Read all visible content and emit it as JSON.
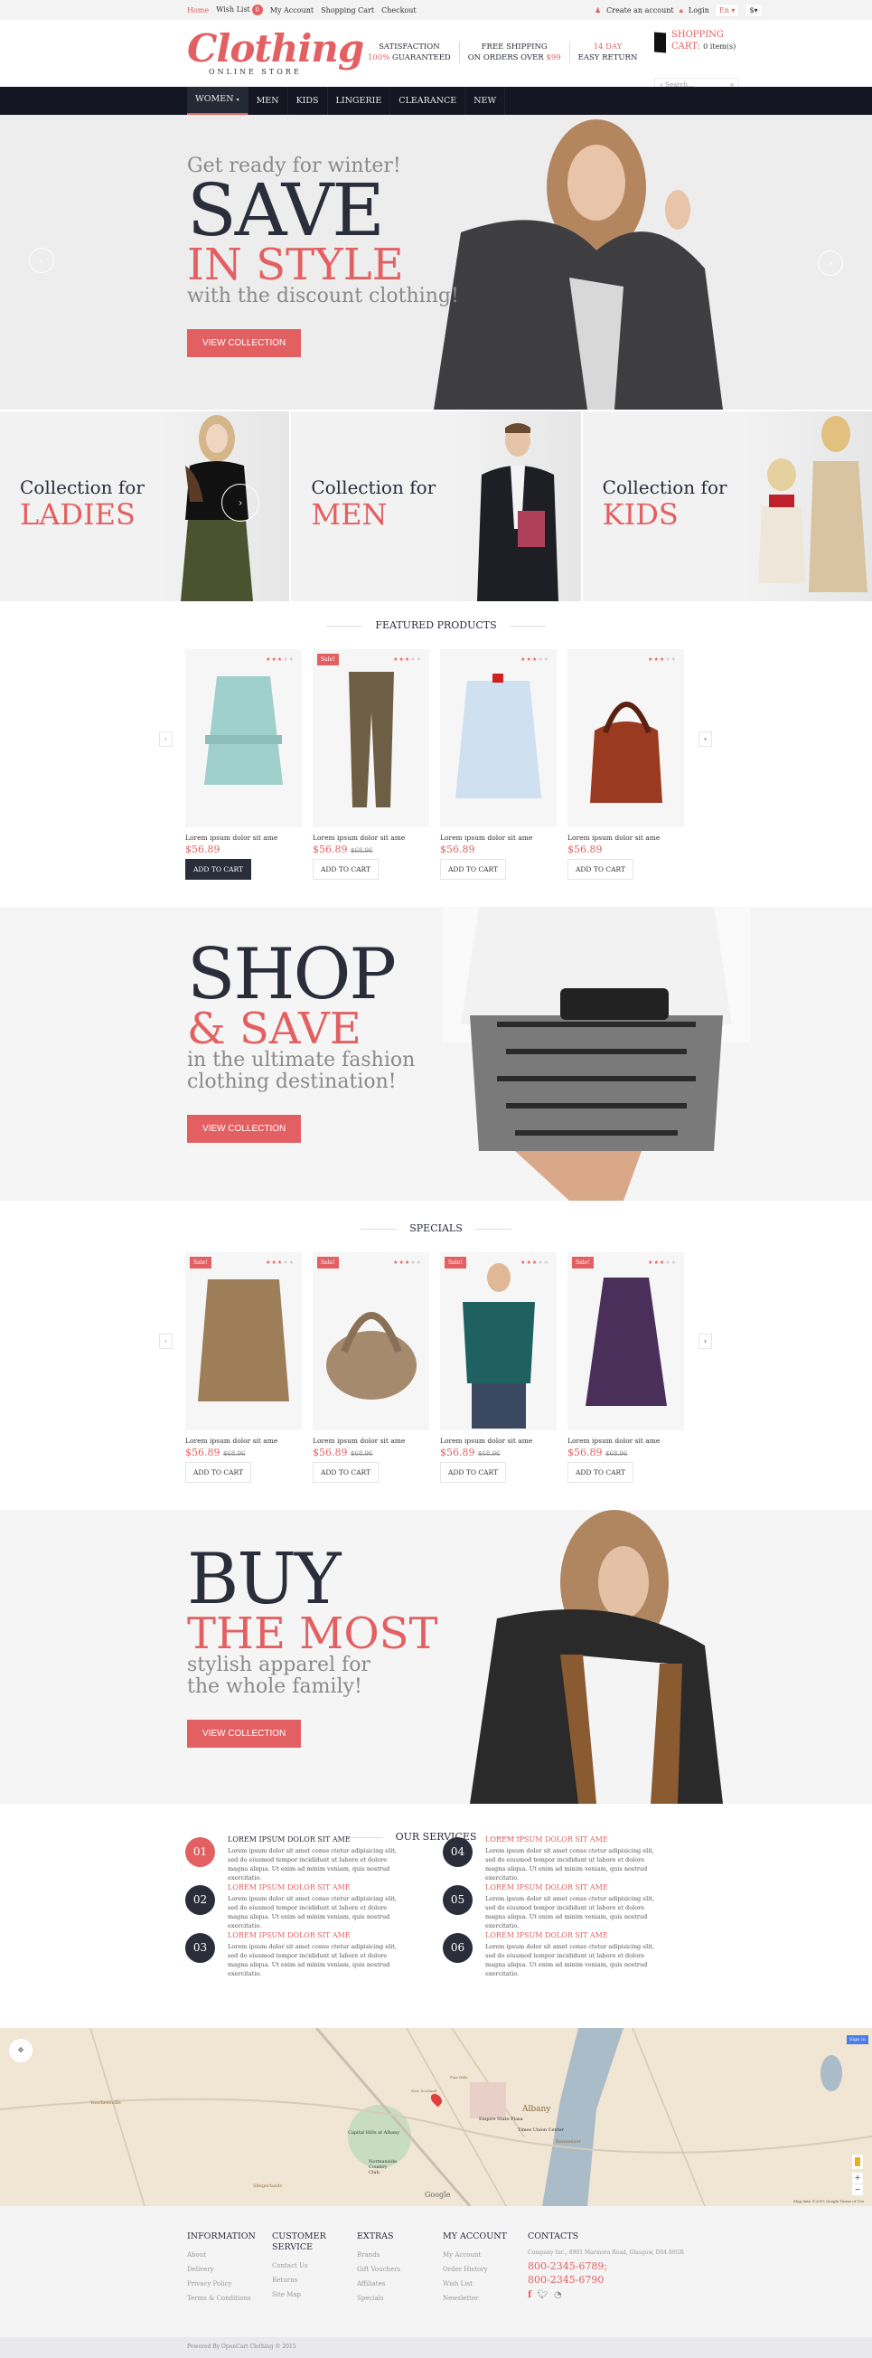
{
  "topbar": {
    "links": [
      "Home",
      "Wish List",
      "My Account",
      "Shopping Cart",
      "Checkout"
    ],
    "wishlist_count": "0",
    "create_account": "Create an account",
    "login": "Login",
    "language": "En",
    "currency": "$"
  },
  "header": {
    "logo_script": "Clothing",
    "logo_sub": "ONLINE STORE",
    "features": [
      {
        "line1": "SATISFACTION",
        "line2_red": "100%",
        "line2": " GUARANTEED"
      },
      {
        "line1": "FREE SHIPPING",
        "line2": "ON ORDERS OVER ",
        "line2_red": "$99"
      },
      {
        "line1_red": "14 DAY",
        "line2": "EASY RETURN"
      }
    ],
    "cart_label": "SHOPPING",
    "cart_label2": "CART:",
    "cart_items": "0 item(s)",
    "search_placeholder": "Search...",
    "search_go": "»"
  },
  "nav": {
    "items": [
      "WOMEN",
      "MEN",
      "KIDS",
      "LINGERIE",
      "CLEARANCE",
      "NEW"
    ],
    "active": "WOMEN"
  },
  "hero": {
    "kicker": "Get ready for winter!",
    "title_dark": "SAVE",
    "title_red": "IN STYLE",
    "subtitle": "with the discount clothing!",
    "button": "VIEW COLLECTION",
    "prev": "‹",
    "next": "›"
  },
  "categories": [
    {
      "line1": "Collection for",
      "line2": "LADIES"
    },
    {
      "line1": "Collection for",
      "line2": "MEN"
    },
    {
      "line1": "Collection for",
      "line2": "KIDS"
    }
  ],
  "featured": {
    "title": "FEATURED PRODUCTS",
    "products": [
      {
        "name": "Lorem ipsum dolor sit ame",
        "price": "$56.89",
        "old_price": "",
        "sale": "",
        "rating": 3,
        "button": "ADD TO CART",
        "image": "mint-trench-coat"
      },
      {
        "name": "Lorem ipsum dolor sit ame",
        "price": "$56.89",
        "old_price": "$68.96",
        "sale": "Sale!",
        "rating": 3,
        "button": "ADD TO CART",
        "image": "olive-trousers"
      },
      {
        "name": "Lorem ipsum dolor sit ame",
        "price": "$56.89",
        "old_price": "",
        "sale": "",
        "rating": 3,
        "button": "ADD TO CART",
        "image": "light-blue-shirt"
      },
      {
        "name": "Lorem ipsum dolor sit ame",
        "price": "$56.89",
        "old_price": "",
        "sale": "",
        "rating": 3,
        "button": "ADD TO CART",
        "image": "brown-leather-bag"
      }
    ]
  },
  "promo1": {
    "title_dark": "SHOP",
    "title_red": "& SAVE",
    "subtitle1": "in the ultimate fashion",
    "subtitle2": "clothing destination!",
    "button": "VIEW COLLECTION"
  },
  "specials": {
    "title": "SPECIALS",
    "products": [
      {
        "name": "Lorem ipsum dolor sit ame",
        "price": "$56.89",
        "old_price": "$68.96",
        "sale": "Sale!",
        "rating": 3,
        "button": "ADD TO CART",
        "image": "suede-shirt"
      },
      {
        "name": "Lorem ipsum dolor sit ame",
        "price": "$56.89",
        "old_price": "$68.96",
        "sale": "Sale!",
        "rating": 3,
        "button": "ADD TO CART",
        "image": "woven-bag"
      },
      {
        "name": "Lorem ipsum dolor sit ame",
        "price": "$56.89",
        "old_price": "$68.96",
        "sale": "Sale!",
        "rating": 3,
        "button": "ADD TO CART",
        "image": "teal-mens-shirt"
      },
      {
        "name": "Lorem ipsum dolor sit ame",
        "price": "$56.89",
        "old_price": "$68.96",
        "sale": "Sale!",
        "rating": 3,
        "button": "ADD TO CART",
        "image": "purple-coat"
      }
    ]
  },
  "promo2": {
    "title_dark": "BUY",
    "title_red": "THE MOST",
    "subtitle1": "stylish apparel for",
    "subtitle2": "the whole family!",
    "button": "VIEW COLLECTION"
  },
  "services": {
    "title": "OUR SERVICES",
    "items": [
      {
        "num": "01",
        "title": "LOREM IPSUM DOLOR SIT AME",
        "text": "Lorem ipsum dolor sit amet conse ctetur adipisicing elit, sed do eiusmod tempor incididunt ut labore et dolore magna aliqua. Ut enim ad minim veniam, quis nostrud exercitatio."
      },
      {
        "num": "02",
        "title": "LOREM IPSUM DOLOR SIT AME",
        "text": "Lorem ipsum dolor sit amet conse ctetur adipisicing elit, sed do eiusmod tempor incididunt ut labore et dolore magna aliqua. Ut enim ad minim veniam, quis nostrud exercitatio."
      },
      {
        "num": "03",
        "title": "LOREM IPSUM DOLOR SIT AME",
        "text": "Lorem ipsum dolor sit amet conse ctetur adipisicing elit, sed do eiusmod tempor incididunt ut labore et dolore magna aliqua. Ut enim ad minim veniam, quis nostrud exercitatio."
      },
      {
        "num": "04",
        "title": "LOREM IPSUM DOLOR SIT AME",
        "text": "Lorem ipsum dolor sit amet conse ctetur adipisicing elit, sed do eiusmod tempor incididunt ut labore et dolore magna aliqua. Ut enim ad minim veniam, quis nostrud exercitatio."
      },
      {
        "num": "05",
        "title": "LOREM IPSUM DOLOR SIT AME",
        "text": "Lorem ipsum dolor sit amet conse ctetur adipisicing elit, sed do eiusmod tempor incididunt ut labore et dolore magna aliqua. Ut enim ad minim veniam, quis nostrud exercitatio."
      },
      {
        "num": "06",
        "title": "LOREM IPSUM DOLOR SIT AME",
        "text": "Lorem ipsum dolor sit amet conse ctetur adipisicing elit, sed do eiusmod tempor incididunt ut labore et dolore magna aliqua. Ut enim ad minim veniam, quis nostrud exercitatio."
      }
    ]
  },
  "map": {
    "labels": [
      "Albany",
      "Empire State Plaza",
      "Times Union Center",
      "Capital Hills at Albany",
      "Normanside Country Club",
      "Voorheesville",
      "Slingerlands",
      "Rensselaer",
      "New Scotland",
      "Pine Hills"
    ],
    "sign_in": "Sign in",
    "google": "Google",
    "attribution": "Map data ©2015 Google",
    "terms": "Terms of Use",
    "zoom_in": "+",
    "zoom_out": "−"
  },
  "footer": {
    "columns": [
      {
        "title": "INFORMATION",
        "links": [
          "About",
          "Delivery",
          "Privacy Policy",
          "Terms & Conditions"
        ]
      },
      {
        "title": "CUSTOMER SERVICE",
        "links": [
          "Contact Us",
          "Returns",
          "Site Map"
        ]
      },
      {
        "title": "EXTRAS",
        "links": [
          "Brands",
          "Gift Vouchers",
          "Affiliates",
          "Specials"
        ]
      },
      {
        "title": "MY ACCOUNT",
        "links": [
          "My Account",
          "Order History",
          "Wish List",
          "Newsletter"
        ]
      }
    ],
    "contacts": {
      "title": "CONTACTS",
      "address": "Company Inc., 8901 Marmora Road, Glasgow, D04 89GR",
      "phone1": "800-2345-6789;",
      "phone2": "800-2345-6790"
    },
    "copyright": "Powered By OpenCart Clothing © 2015"
  },
  "colors": {
    "accent": "#e36062",
    "dark": "#2a2d3a",
    "nav": "#141722"
  }
}
